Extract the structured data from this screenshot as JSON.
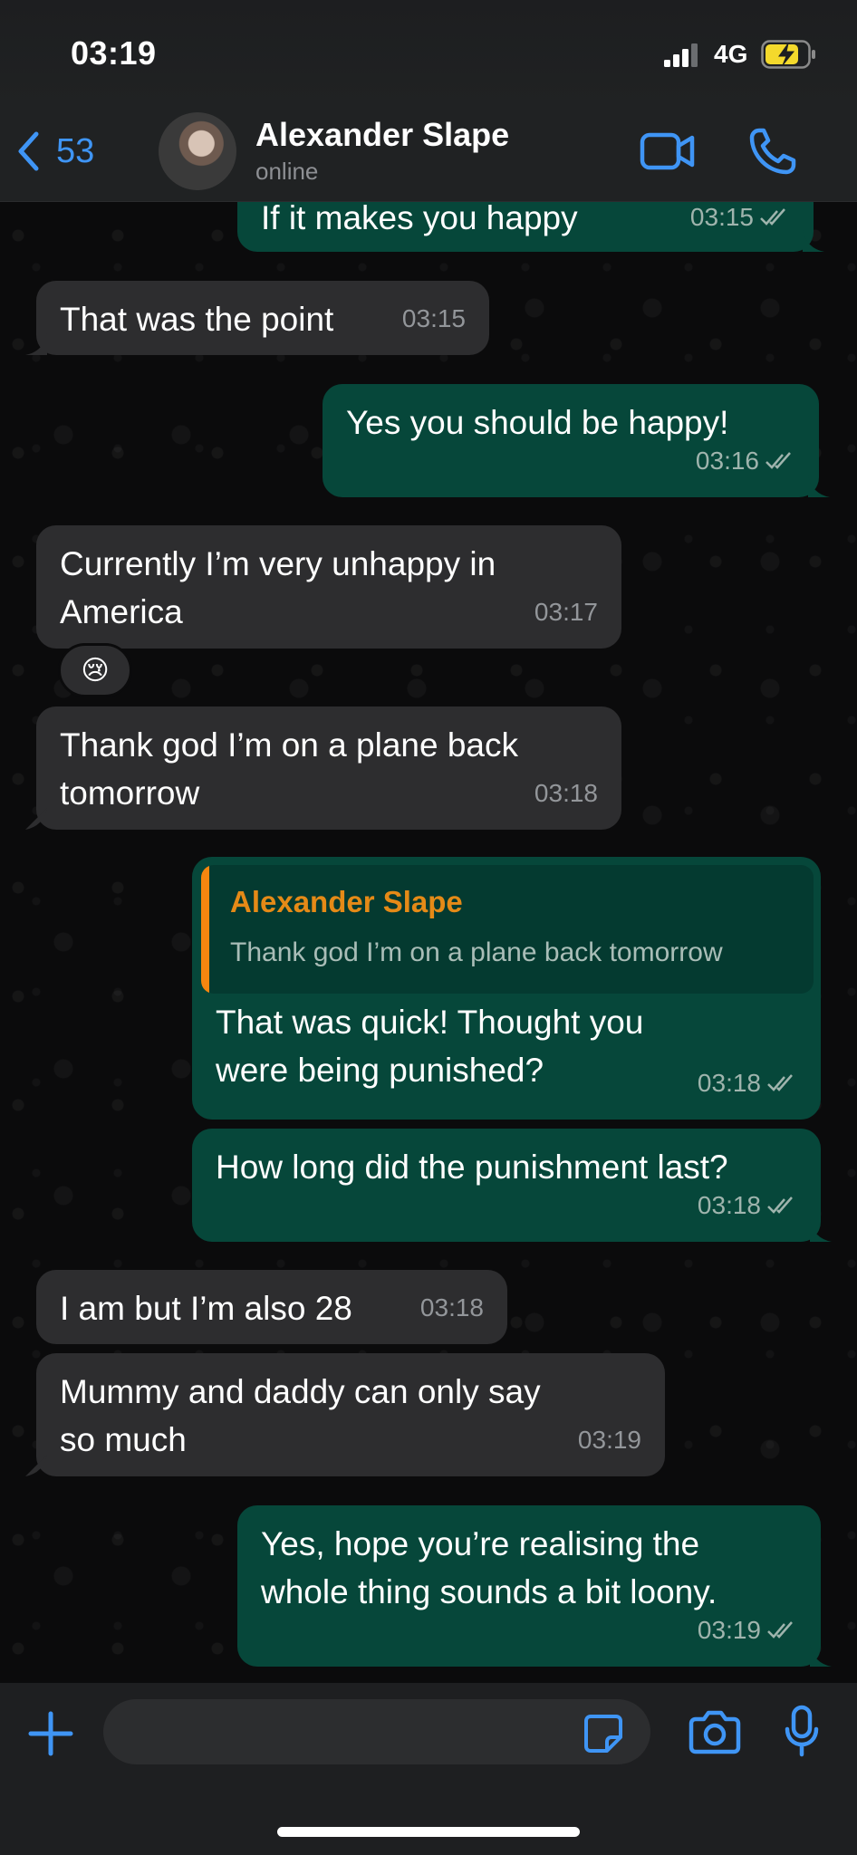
{
  "status_bar": {
    "time": "03:19",
    "network": "4G"
  },
  "header": {
    "back_count": "53",
    "contact_name": "Alexander Slape",
    "contact_status": "online"
  },
  "messages": [
    {
      "direction": "out",
      "text": "If it makes you happy",
      "time": "03:15"
    },
    {
      "direction": "in",
      "text": "That was the point",
      "time": "03:15"
    },
    {
      "direction": "out",
      "text": "Yes you should be happy!",
      "time": "03:16"
    },
    {
      "direction": "in",
      "text": "Currently I’m very unhappy in America",
      "time": "03:17",
      "reaction": "😢"
    },
    {
      "direction": "in",
      "text": "Thank god I’m on a plane back tomorrow",
      "time": "03:18"
    },
    {
      "direction": "out",
      "text": "That was quick! Thought you were being punished?",
      "time": "03:18",
      "reply_to": {
        "name": "Alexander Slape",
        "text": "Thank god I’m on a plane back tomorrow"
      }
    },
    {
      "direction": "out",
      "text": "How long did the punishment last?",
      "time": "03:18"
    },
    {
      "direction": "in",
      "text": "I am but I’m also 28",
      "time": "03:18"
    },
    {
      "direction": "in",
      "text": "Mummy and daddy can only say so much",
      "time": "03:19"
    },
    {
      "direction": "out",
      "text": "Yes, hope you’re realising the whole thing sounds a bit loony.",
      "time": "03:19"
    }
  ],
  "composer": {
    "placeholder": ""
  },
  "colors": {
    "accent": "#3f95f5",
    "outgoing_bubble": "#06473a",
    "incoming_bubble": "#2d2d2f",
    "reply_name": "#e58a17"
  },
  "icons": [
    "back-chevron-icon",
    "video-call-icon",
    "phone-icon",
    "plus-icon",
    "sticker-icon",
    "camera-icon",
    "microphone-icon",
    "double-check-icon"
  ]
}
